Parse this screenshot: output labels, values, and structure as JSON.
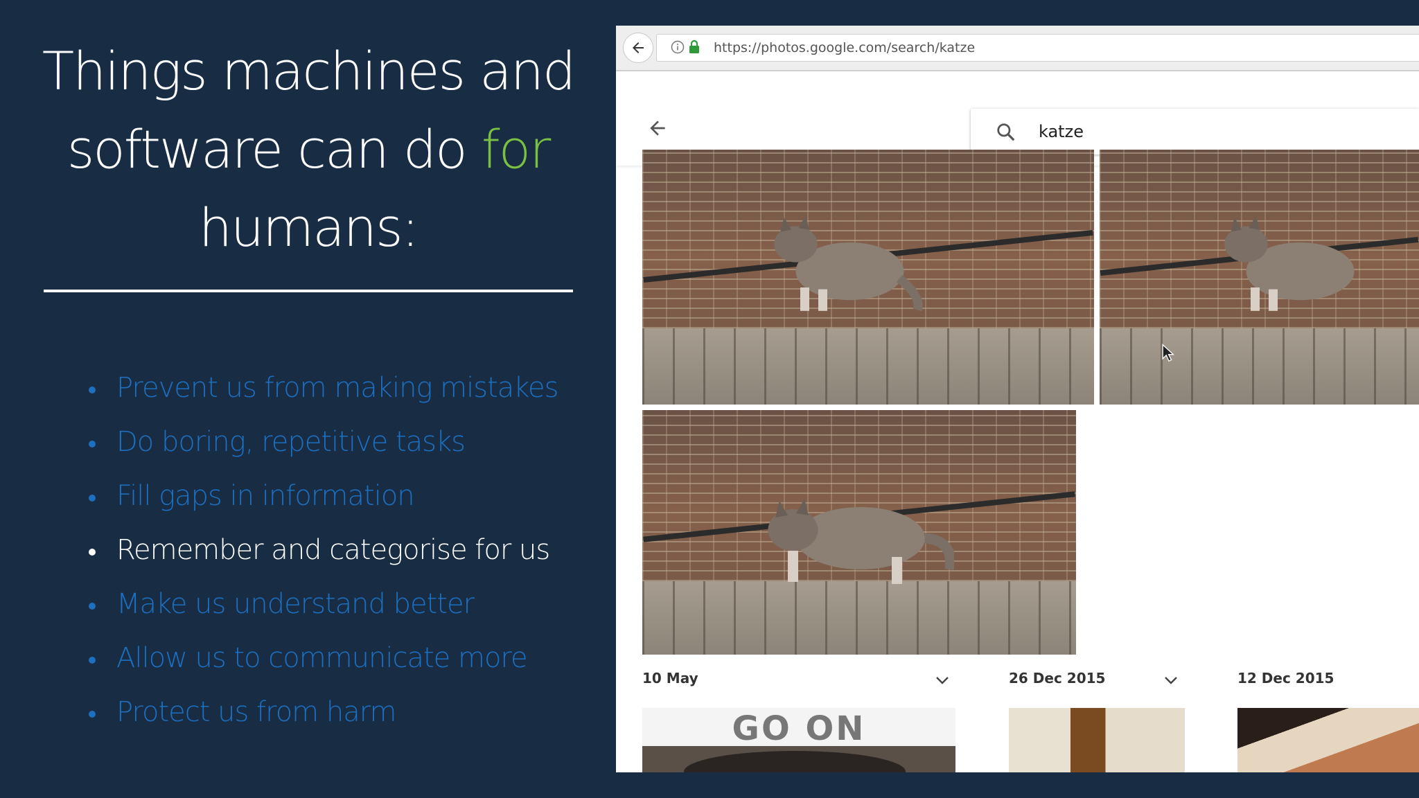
{
  "slide": {
    "title_pre": "Things machines and software can do ",
    "title_highlight": "for",
    "title_post": " humans:",
    "bullets": [
      {
        "text": "Prevent us from making mistakes",
        "active": false
      },
      {
        "text": "Do boring, repetitive tasks",
        "active": false
      },
      {
        "text": "Fill gaps in information",
        "active": false
      },
      {
        "text": "Remember and categorise for us",
        "active": true
      },
      {
        "text": "Make us understand better",
        "active": false
      },
      {
        "text": "Allow us to communicate more",
        "active": false
      },
      {
        "text": "Protect us from harm",
        "active": false
      }
    ]
  },
  "browser": {
    "url": "https://photos.google.com/search/katze",
    "search_query": "katze",
    "date_groups": [
      {
        "label": "10 May"
      },
      {
        "label": "26 Dec 2015"
      },
      {
        "label": "12 Dec 2015"
      }
    ],
    "thumbnail_caption": "GO ON"
  },
  "colors": {
    "background": "#182c44",
    "highlight": "#7ac143",
    "bullet_inactive": "#1d6fc0",
    "bullet_active": "#ffffff"
  }
}
